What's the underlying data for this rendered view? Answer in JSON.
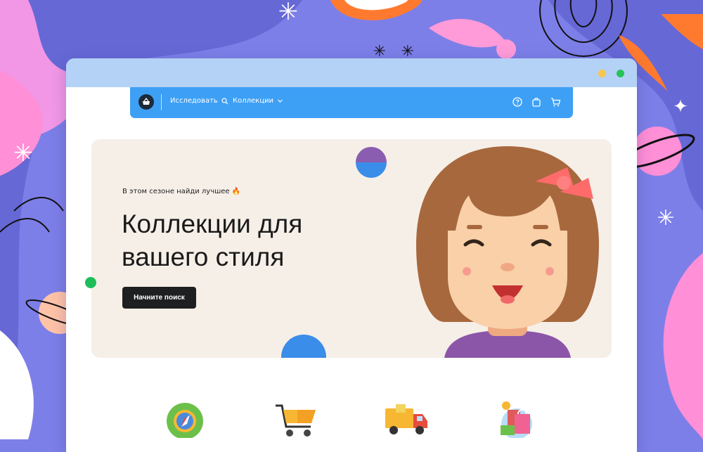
{
  "colors": {
    "background": "#7d7fe8",
    "titlebar": "#b3d2f6",
    "navbar": "#3da0f5",
    "hero_bg": "#f6efe8",
    "cta_bg": "#1e1f21"
  },
  "window": {
    "controls": [
      "minimize",
      "maximize"
    ]
  },
  "navbar": {
    "logo_icon": "basket-icon",
    "explore_label": "Исследовать",
    "explore_icon": "search-icon",
    "collections_label": "Коллекции",
    "collections_icon": "chevron-down-icon",
    "right_icons": [
      "help-icon",
      "shopping-bag-icon",
      "cart-icon"
    ]
  },
  "hero": {
    "eyebrow": "В этом сезоне найди лучшее 🔥",
    "title": "Коллекции для вашего стиля",
    "cta_label": "Начните поиск",
    "illustration": "smiling-girl-illustration"
  },
  "features": [
    "compass-icon",
    "shopping-cart-icon",
    "delivery-truck-icon",
    "gift-shopping-icon"
  ]
}
